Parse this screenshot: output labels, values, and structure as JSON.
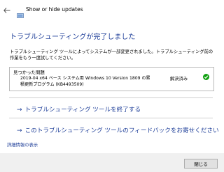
{
  "window": {
    "title": "Show or hide updates"
  },
  "main": {
    "heading": "トラブルシューティングが完了しました",
    "description": "トラブルシューティング ツールによってシステムが一部変更されました。トラブルシューティング前の作業をもう一度試してください。"
  },
  "problems": {
    "header": "見つかった問題",
    "items": [
      {
        "description": "2019-04 x64 ベース システム用 Windows 10 Version 1809 の累積更新プログラム (KB4493509)",
        "status": "解決済み",
        "status_icon": "check-circle-icon"
      }
    ]
  },
  "actions": {
    "close_troubleshooter": "トラブルシューティング ツールを終了する",
    "feedback": "このトラブルシューティング ツールのフィードバックをお寄せください"
  },
  "links": {
    "details": "詳細情報の表示"
  },
  "footer": {
    "close_button": "閉じる"
  },
  "colors": {
    "link": "#1f3f99",
    "success": "#10a010",
    "footer_bg": "#f0f0f0"
  }
}
